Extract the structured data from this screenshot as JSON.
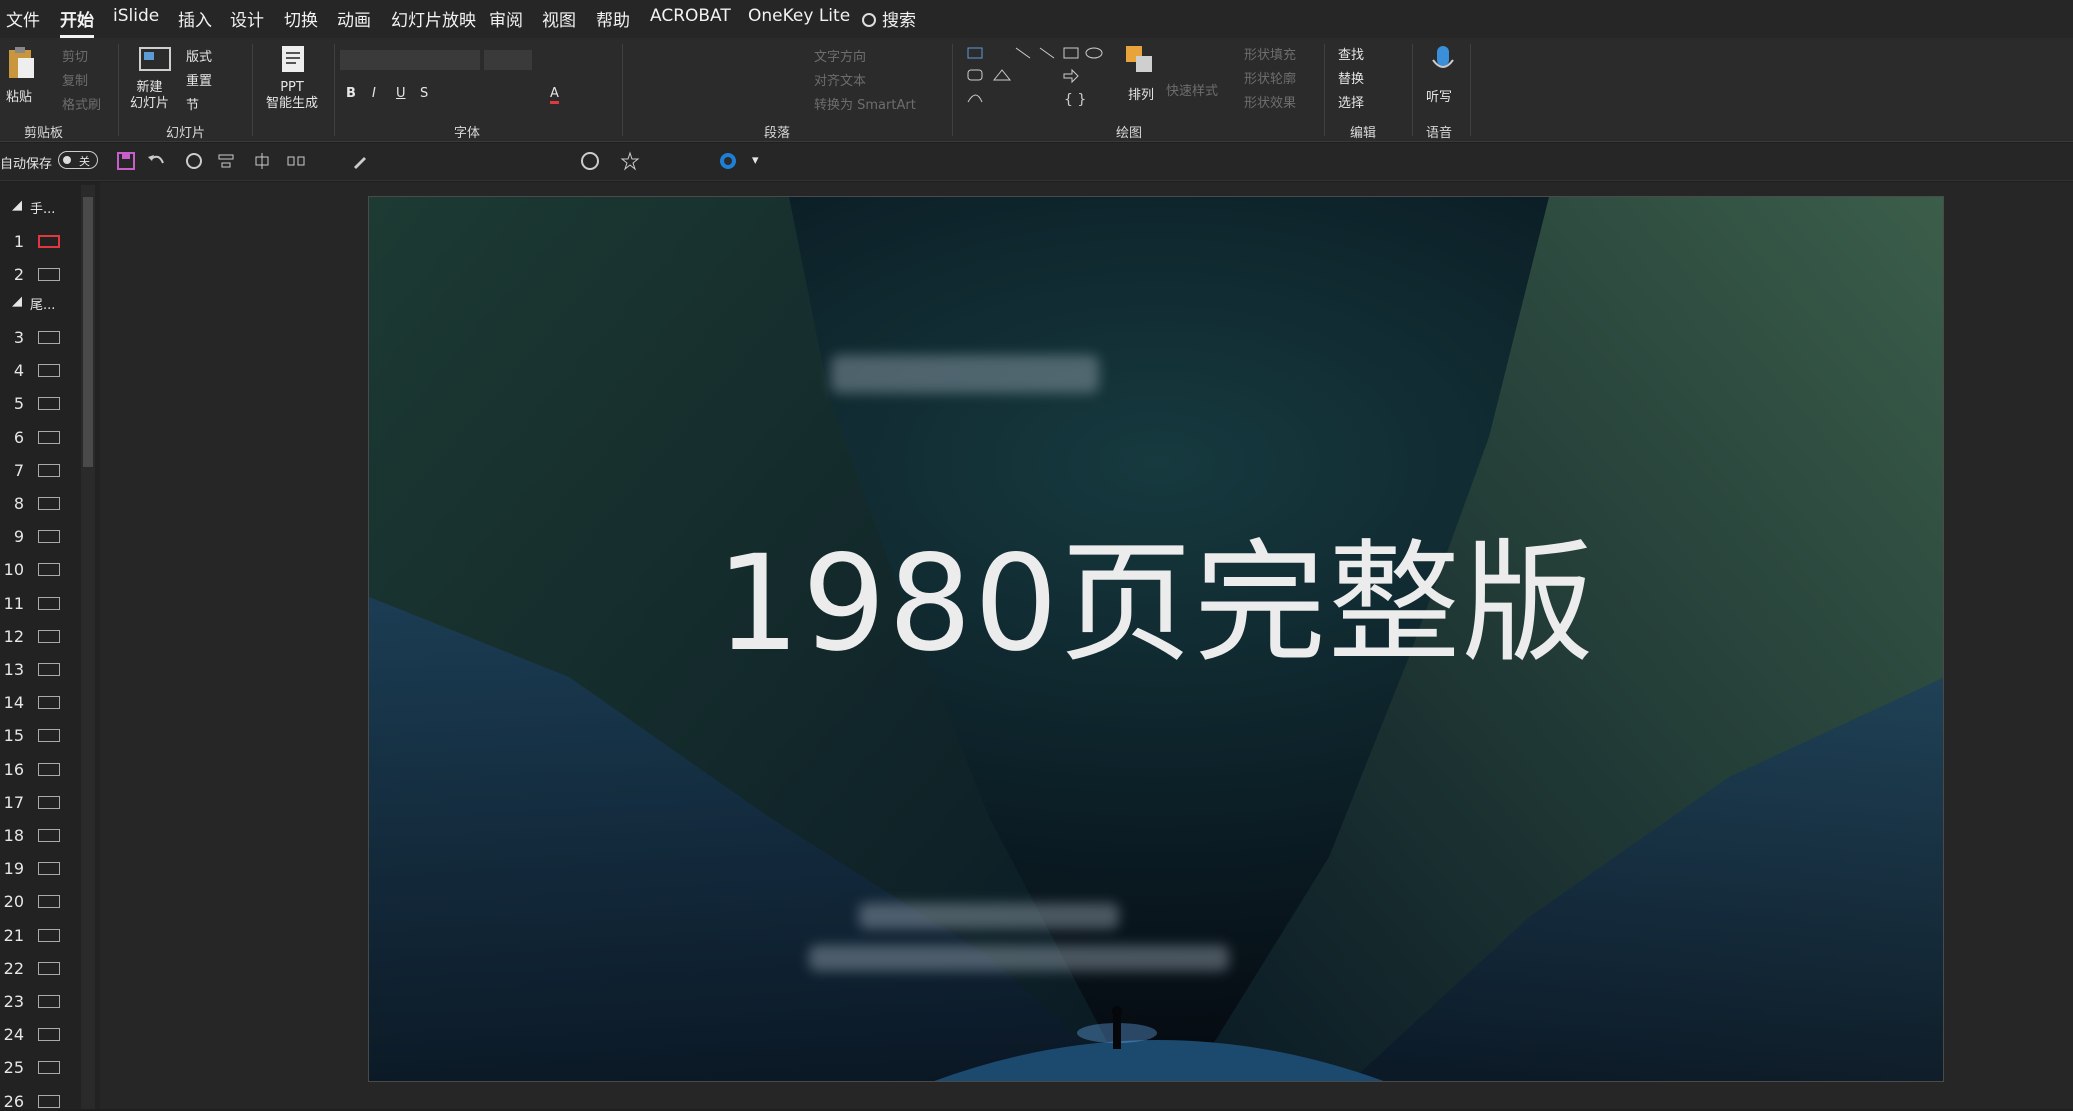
{
  "menu": {
    "items": [
      "文件",
      "开始",
      "iSlide",
      "插入",
      "设计",
      "切换",
      "动画",
      "幻灯片放映",
      "审阅",
      "视图",
      "帮助",
      "ACROBAT",
      "OneKey Lite"
    ],
    "search": "搜索"
  },
  "ribbon": {
    "paste": "粘贴",
    "cut": "剪切",
    "copy": "复制",
    "format_painter": "格式刷",
    "clipboard": "剪贴板",
    "new_slide": "新建\n幻灯片",
    "layout": "版式",
    "reset": "重置",
    "section": "节",
    "slides": "幻灯片",
    "ppt_ai": "PPT\n智能生成",
    "font": "字体",
    "text_direction": "文字方向",
    "align_text": "对齐文本",
    "convert_smartart": "转换为 SmartArt",
    "paragraph": "段落",
    "arrange": "排列",
    "quick_styles": "快速样式",
    "shape_fill": "形状填充",
    "shape_outline": "形状轮廓",
    "shape_effects": "形状效果",
    "drawing": "绘图",
    "find": "查找",
    "replace": "替换",
    "select": "选择",
    "editing": "编辑",
    "dictate": "听写",
    "voice": "语音"
  },
  "quick": {
    "autosave_label": "自动保存",
    "autosave_state": "关"
  },
  "panel": {
    "section1": "手...",
    "section2": "尾...",
    "slides": [
      "1",
      "2",
      "3",
      "4",
      "5",
      "6",
      "7",
      "8",
      "9",
      "10",
      "11",
      "12",
      "13",
      "14",
      "15",
      "16",
      "17",
      "18",
      "19",
      "20",
      "21",
      "22",
      "23",
      "24",
      "25",
      "26"
    ]
  },
  "slide": {
    "title": "1980页完整版"
  },
  "colors": {
    "accent": "#e0383e",
    "window": "#262626",
    "ribbon": "#2b2b2b"
  }
}
